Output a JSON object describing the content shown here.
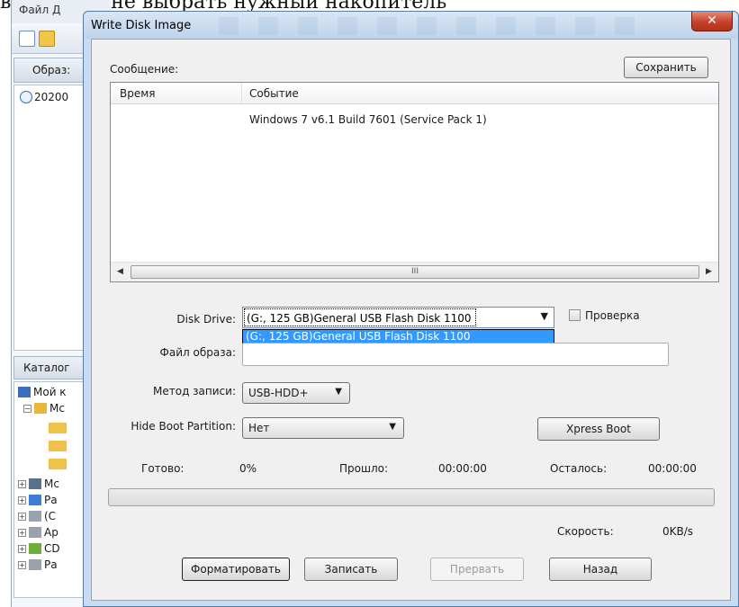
{
  "top_caption": "вшемся окне выбрать нужный накопитель",
  "bg_app": {
    "menu": "Файл  Д",
    "tab1_label": "Образ:",
    "tree1_item": "20200",
    "tab2_label": "Каталог",
    "tree2_items": [
      "Мой к",
      "Мс",
      "Мс",
      "Ра",
      "(С",
      "Ар",
      "CD",
      "Ра"
    ]
  },
  "dialog": {
    "title": "Write Disk Image",
    "close_glyph": "✕",
    "message_label": "Сообщение:",
    "save_button": "Сохранить",
    "log": {
      "columns": [
        "Время",
        "Событие"
      ],
      "rows": [
        {
          "time": "",
          "event": "Windows 7 v6.1 Build 7601 (Service Pack 1)"
        }
      ],
      "scroll_grip": "III"
    },
    "disk_drive": {
      "label": "Disk Drive:",
      "value": "(G:, 125 GB)General USB Flash Disk  1100",
      "options": [
        "(G:, 125 GB)General USB Flash Disk  1100"
      ]
    },
    "verify": {
      "label": "Проверка",
      "checked": false
    },
    "image_file": {
      "label": "Файл образа:",
      "value": ""
    },
    "write_method": {
      "label": "Метод записи:",
      "value": "USB-HDD+"
    },
    "hide_boot": {
      "label": "Hide Boot Partition:",
      "value": "Нет"
    },
    "xpress_button": "Xpress Boot",
    "status": {
      "ready_label": "Готово:",
      "ready_value": "0%",
      "elapsed_label": "Прошло:",
      "elapsed_value": "00:00:00",
      "remaining_label": "Осталось:",
      "remaining_value": "00:00:00",
      "speed_label": "Скорость:",
      "speed_value": "0KB/s"
    },
    "progress_fraction": 0.0,
    "buttons": {
      "format": "Форматировать",
      "write": "Записать",
      "abort": "Прервать",
      "back": "Назад"
    }
  },
  "colors": {
    "selection": "#3399ff",
    "titlebar": "#c9dbf0",
    "close": "#c6412a"
  }
}
